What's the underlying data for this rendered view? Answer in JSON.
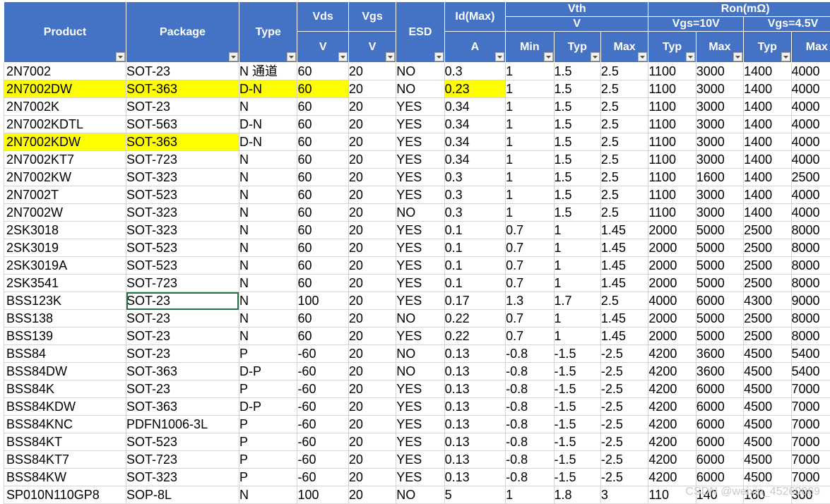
{
  "headers": {
    "product": "Product",
    "package": "Package",
    "type": "Type",
    "vds": "Vds",
    "vds_unit": "V",
    "vgs": "Vgs",
    "vgs_unit": "V",
    "esd": "ESD",
    "id": "Id(Max)",
    "id_unit": "A",
    "vth": "Vth",
    "vth_unit": "V",
    "vth_min": "Min",
    "vth_typ": "Typ",
    "vth_max": "Max",
    "ron": "Ron(mΩ)",
    "ron_vgs10": "Vgs=10V",
    "ron_vgs45": "Vgs=4.5V",
    "ron10_typ": "Typ",
    "ron10_max": "Max",
    "ron45_typ": "Typ",
    "ron45_max": "Max"
  },
  "rows": [
    [
      "2N7002",
      "SOT-23",
      "N 通道",
      "60",
      "20",
      "NO",
      "0.3",
      "1",
      "1.5",
      "2.5",
      "1100",
      "3000",
      "1400",
      "4000"
    ],
    [
      "2N7002DW",
      "SOT-363",
      "D-N",
      "60",
      "20",
      "NO",
      "0.23",
      "1",
      "1.5",
      "2.5",
      "1100",
      "3000",
      "1400",
      "4000"
    ],
    [
      "2N7002K",
      "SOT-23",
      "N",
      "60",
      "20",
      "YES",
      "0.34",
      "1",
      "1.5",
      "2.5",
      "1100",
      "3000",
      "1400",
      "4000"
    ],
    [
      "2N7002KDTL",
      "SOT-563",
      "D-N",
      "60",
      "20",
      "YES",
      "0.34",
      "1",
      "1.5",
      "2.5",
      "1100",
      "3000",
      "1400",
      "4000"
    ],
    [
      "2N7002KDW",
      "SOT-363",
      "D-N",
      "60",
      "20",
      "YES",
      "0.34",
      "1",
      "1.5",
      "2.5",
      "1100",
      "3000",
      "1400",
      "4000"
    ],
    [
      "2N7002KT7",
      "SOT-723",
      "N",
      "60",
      "20",
      "YES",
      "0.34",
      "1",
      "1.5",
      "2.5",
      "1100",
      "3000",
      "1400",
      "4000"
    ],
    [
      "2N7002KW",
      "SOT-323",
      "N",
      "60",
      "20",
      "YES",
      "0.3",
      "1",
      "1.5",
      "2.5",
      "1100",
      "1600",
      "1400",
      "2500"
    ],
    [
      "2N7002T",
      "SOT-523",
      "N",
      "60",
      "20",
      "YES",
      "0.3",
      "1",
      "1.5",
      "2.5",
      "1100",
      "3000",
      "1400",
      "4000"
    ],
    [
      "2N7002W",
      "SOT-323",
      "N",
      "60",
      "20",
      "NO",
      "0.3",
      "1",
      "1.5",
      "2.5",
      "1100",
      "3000",
      "1400",
      "4000"
    ],
    [
      "2SK3018",
      "SOT-323",
      "N",
      "60",
      "20",
      "YES",
      "0.1",
      "0.7",
      "1",
      "1.45",
      "2000",
      "5000",
      "2500",
      "8000"
    ],
    [
      "2SK3019",
      "SOT-523",
      "N",
      "60",
      "20",
      "YES",
      "0.1",
      "0.7",
      "1",
      "1.45",
      "2000",
      "5000",
      "2500",
      "8000"
    ],
    [
      "2SK3019A",
      "SOT-523",
      "N",
      "60",
      "20",
      "YES",
      "0.1",
      "0.7",
      "1",
      "1.45",
      "2000",
      "5000",
      "2500",
      "8000"
    ],
    [
      "2SK3541",
      "SOT-723",
      "N",
      "60",
      "20",
      "YES",
      "0.1",
      "0.7",
      "1",
      "1.45",
      "2000",
      "5000",
      "2500",
      "8000"
    ],
    [
      "BSS123K",
      "SOT-23",
      "N",
      "100",
      "20",
      "YES",
      "0.17",
      "1.3",
      "1.7",
      "2.5",
      "4000",
      "6000",
      "4300",
      "9000"
    ],
    [
      "BSS138",
      "SOT-23",
      "N",
      "60",
      "20",
      "NO",
      "0.22",
      "0.7",
      "1",
      "1.45",
      "2000",
      "5000",
      "2500",
      "8000"
    ],
    [
      "BSS139",
      "SOT-23",
      "N",
      "60",
      "20",
      "YES",
      "0.22",
      "0.7",
      "1",
      "1.45",
      "2000",
      "5000",
      "2500",
      "8000"
    ],
    [
      "BSS84",
      "SOT-23",
      "P",
      "-60",
      "20",
      "NO",
      "0.13",
      "-0.8",
      "-1.5",
      "-2.5",
      "4200",
      "3600",
      "4500",
      "5400"
    ],
    [
      "BSS84DW",
      "SOT-363",
      "D-P",
      "-60",
      "20",
      "NO",
      "0.13",
      "-0.8",
      "-1.5",
      "-2.5",
      "4200",
      "3600",
      "4500",
      "5400"
    ],
    [
      "BSS84K",
      "SOT-23",
      "P",
      "-60",
      "20",
      "YES",
      "0.13",
      "-0.8",
      "-1.5",
      "-2.5",
      "4200",
      "6000",
      "4500",
      "7000"
    ],
    [
      "BSS84KDW",
      "SOT-363",
      "D-P",
      "-60",
      "20",
      "YES",
      "0.13",
      "-0.8",
      "-1.5",
      "-2.5",
      "4200",
      "6000",
      "4500",
      "7000"
    ],
    [
      "BSS84KNC",
      "PDFN1006-3L",
      "P",
      "-60",
      "20",
      "YES",
      "0.13",
      "-0.8",
      "-1.5",
      "-2.5",
      "4200",
      "6000",
      "4500",
      "7000"
    ],
    [
      "BSS84KT",
      "SOT-523",
      "P",
      "-60",
      "20",
      "YES",
      "0.13",
      "-0.8",
      "-1.5",
      "-2.5",
      "4200",
      "6000",
      "4500",
      "7000"
    ],
    [
      "BSS84KT7",
      "SOT-723",
      "P",
      "-60",
      "20",
      "YES",
      "0.13",
      "-0.8",
      "-1.5",
      "-2.5",
      "4200",
      "6000",
      "4500",
      "7000"
    ],
    [
      "BSS84KW",
      "SOT-323",
      "P",
      "-60",
      "20",
      "YES",
      "0.13",
      "-0.8",
      "-1.5",
      "-2.5",
      "4200",
      "6000",
      "4500",
      "7000"
    ],
    [
      "SP010N110GP8",
      "SOP-8L",
      "N",
      "100",
      "20",
      "NO",
      "5",
      "1",
      "1.8",
      "3",
      "110",
      "140",
      "160",
      "300"
    ]
  ],
  "highlights": [
    {
      "row": 1,
      "col": 0
    },
    {
      "row": 1,
      "col": 1
    },
    {
      "row": 1,
      "col": 2
    },
    {
      "row": 1,
      "col": 3
    },
    {
      "row": 1,
      "col": 6
    },
    {
      "row": 4,
      "col": 0
    },
    {
      "row": 4,
      "col": 1
    }
  ],
  "selected_cell": {
    "row": 13,
    "col": 1
  },
  "colors": {
    "header_bg": "#4472c4",
    "highlight": "#ffff00",
    "selection": "#217346"
  },
  "watermark": "CSDN @weixin_45260069"
}
